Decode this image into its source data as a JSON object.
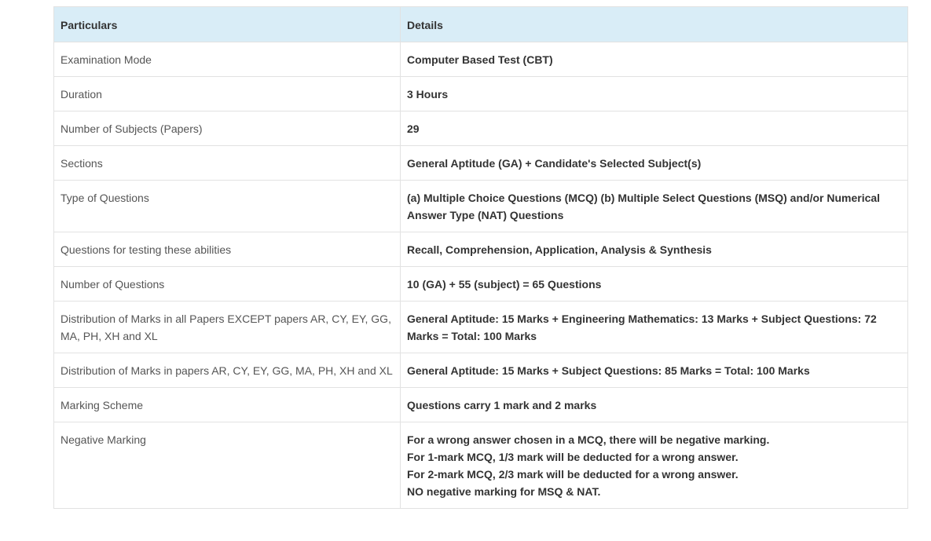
{
  "table": {
    "headers": [
      "Particulars",
      "Details"
    ],
    "rows": [
      {
        "particular": "Examination Mode",
        "details": [
          "Computer Based Test (CBT)"
        ]
      },
      {
        "particular": "Duration",
        "details": [
          "3 Hours"
        ]
      },
      {
        "particular": "Number of Subjects (Papers)",
        "details": [
          "29"
        ]
      },
      {
        "particular": "Sections",
        "details": [
          "General Aptitude (GA) + Candidate's Selected Subject(s)"
        ]
      },
      {
        "particular": "Type of Questions",
        "details": [
          "(a) Multiple Choice Questions (MCQ) (b) Multiple Select Questions (MSQ) and/or Numerical Answer Type (NAT) Questions"
        ]
      },
      {
        "particular": "Questions for testing these abilities",
        "details": [
          "Recall, Comprehension, Application, Analysis & Synthesis"
        ]
      },
      {
        "particular": "Number of Questions",
        "details": [
          "10 (GA) + 55 (subject) = 65 Questions"
        ]
      },
      {
        "particular": "Distribution of Marks in all Papers EXCEPT papers AR, CY, EY, GG, MA, PH, XH and XL",
        "details": [
          "General Aptitude: 15 Marks + Engineering Mathematics: 13 Marks + Subject Questions: 72 Marks = Total: 100 Marks"
        ]
      },
      {
        "particular": "Distribution of Marks in papers AR, CY, EY, GG, MA, PH, XH and XL",
        "details": [
          "General Aptitude: 15 Marks + Subject Questions: 85 Marks = Total: 100 Marks"
        ]
      },
      {
        "particular": "Marking Scheme",
        "details": [
          "Questions carry 1 mark and 2 marks"
        ]
      },
      {
        "particular": "Negative Marking",
        "details": [
          "For a wrong answer chosen in a MCQ, there will be negative marking.",
          "For 1-mark MCQ, 1/3 mark will be deducted for a wrong answer.",
          "For 2-mark MCQ, 2/3 mark will be deducted for a wrong answer.",
          "NO negative marking for MSQ & NAT."
        ]
      }
    ]
  },
  "colors": {
    "header_bg": "#d9edf7",
    "border": "#e2e2e2",
    "text": "#333333"
  }
}
